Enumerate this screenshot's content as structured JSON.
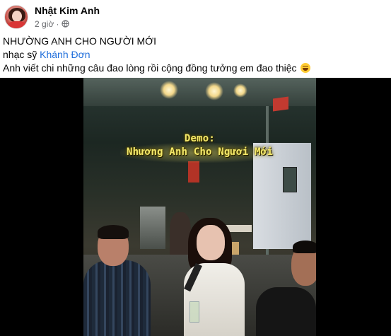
{
  "post": {
    "author": "Nhật Kim Anh",
    "time": "2 giờ",
    "audience_icon": "globe-icon",
    "text": {
      "line1": "NHƯỜNG ANH CHO NGƯỜI MỚI",
      "line2_prefix": "nhạc sỹ ",
      "line2_mention": "Khánh Đơn",
      "line3": "Anh viết chi những câu đao lòng rồi cộng đồng tưởng em đao thiệc",
      "emoji": "laughing-emoji"
    }
  },
  "video": {
    "caption_line1": "Demo:",
    "caption_line2": "Nhương Anh Cho Ngươi Mới"
  },
  "colors": {
    "mention": "#216fdb",
    "caption": "#f5e96a",
    "meta_text": "#65676b"
  }
}
